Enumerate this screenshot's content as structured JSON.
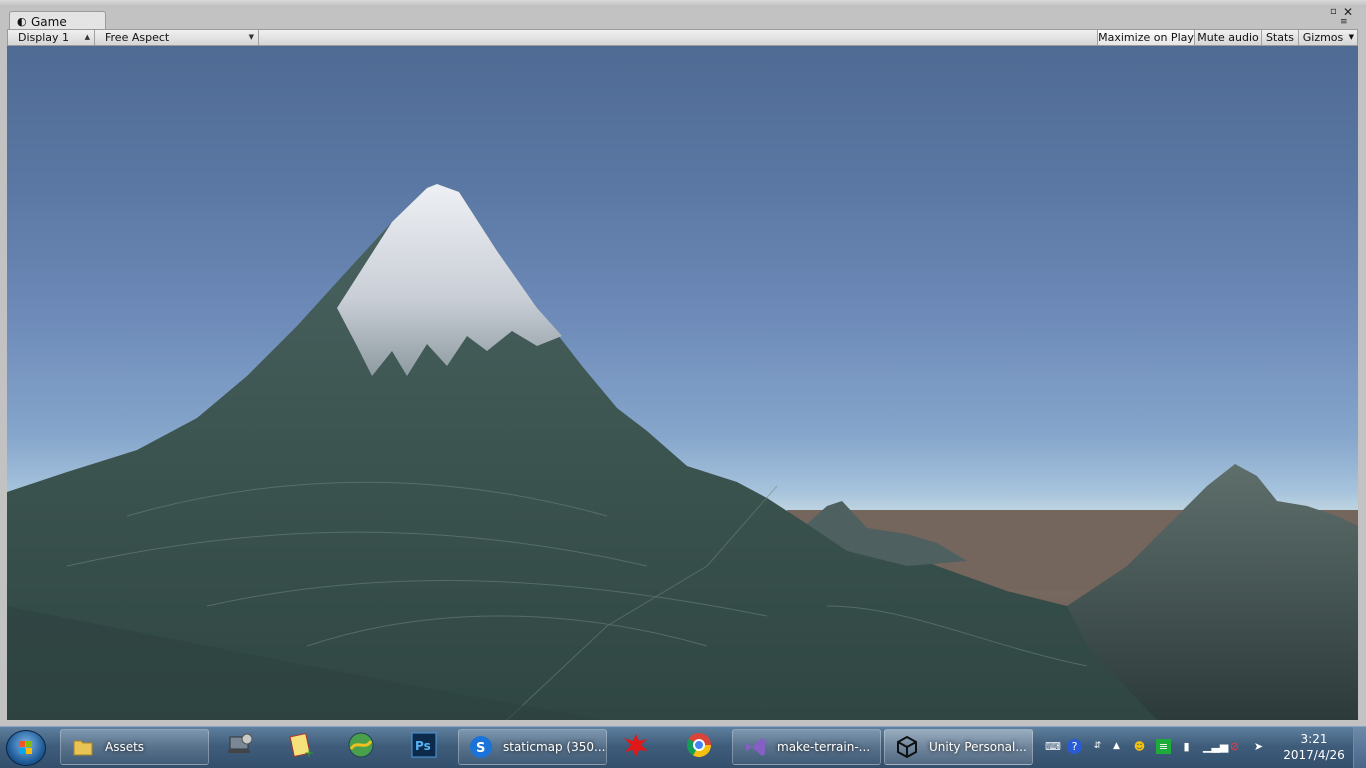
{
  "window": {
    "tab_title": "Game",
    "tab_icon": "game-controller-icon"
  },
  "toolbar": {
    "display_select": "Display 1",
    "aspect_select": "Free Aspect",
    "maximize_on_play": "Maximize on Play",
    "mute_audio": "Mute audio",
    "stats": "Stats",
    "gizmos": "Gizmos"
  },
  "taskbar": {
    "items": [
      {
        "label": "Assets",
        "icon": "folder-icon"
      },
      {
        "label": "staticmap (350...",
        "icon": "sogou-icon"
      },
      {
        "label": "make-terrain-...",
        "icon": "visual-studio-icon"
      },
      {
        "label": "Unity Personal...",
        "icon": "unity-icon"
      }
    ],
    "pinned": [
      "network-settings-icon",
      "notepad-plus-icon",
      "map-app-icon",
      "photoshop-icon",
      "paint-splash-icon",
      "chrome-icon"
    ],
    "clock_time": "3:21",
    "clock_date": "2017/4/26"
  },
  "colors": {
    "sky_top": "#4f6b94",
    "horizon": "#c6d9e2",
    "mountain": "#3f5956",
    "snow": "#d9dde3",
    "taskbar": "#3f5d7b"
  }
}
